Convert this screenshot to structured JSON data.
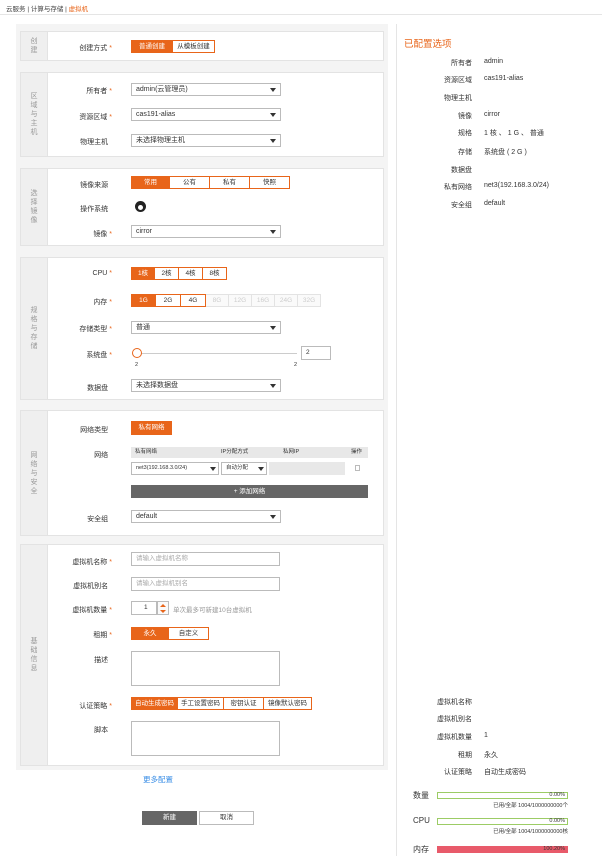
{
  "breadcrumb": {
    "a": "云服务",
    "sep1": "|",
    "b": "计算与存储",
    "sep2": "|",
    "c": "虚拟机"
  },
  "sections": {
    "create": "创建",
    "region": "区域与主机",
    "image": "选择镜像",
    "spec": "规格与存储",
    "network": "网络与安全",
    "basic": "基础信息"
  },
  "create": {
    "label": "创建方式",
    "opt1": "普通创建",
    "opt2": "从模板创建"
  },
  "owner": {
    "label": "所有者",
    "value": "admin(云管理员)"
  },
  "region": {
    "label": "资源区域",
    "value": "cas191-alias"
  },
  "host": {
    "label": "物理主机",
    "value": "未选择物理主机"
  },
  "img_source": {
    "label": "镜像来源",
    "opts": [
      "常用",
      "公有",
      "私有",
      "快照"
    ]
  },
  "os": {
    "label": "操作系统"
  },
  "image": {
    "label": "镜像",
    "value": "cirror"
  },
  "cpu": {
    "label": "CPU",
    "opts": [
      "1核",
      "2核",
      "4核",
      "8核"
    ]
  },
  "mem": {
    "label": "内存",
    "opts": [
      "1G",
      "2G",
      "4G",
      "8G",
      "12G",
      "16G",
      "24G",
      "32G"
    ]
  },
  "storage_type": {
    "label": "存储类型",
    "value": "普通"
  },
  "sysdisk": {
    "label": "系统盘",
    "value": "2",
    "min": "2",
    "max": "2"
  },
  "datadisk": {
    "label": "数据盘",
    "value": "未选择数据盘"
  },
  "nettype": {
    "label": "网络类型",
    "value": "私有网络"
  },
  "network": {
    "label": "网络",
    "headers": [
      "私有网络",
      "IP分配方式",
      "私网IP",
      "操作"
    ],
    "net": "net3(192.168.3.0/24)",
    "alloc": "自动分配",
    "add": "+ 添加网络"
  },
  "secgroup": {
    "label": "安全组",
    "value": "default"
  },
  "vmname": {
    "label": "虚拟机名称",
    "placeholder": "请输入虚拟机名称"
  },
  "vmalias": {
    "label": "虚拟机别名",
    "placeholder": "请输入虚拟机别名"
  },
  "vmcount": {
    "label": "虚拟机数量",
    "value": "1",
    "hint": "单次最多可新建10台虚拟机"
  },
  "lease": {
    "label": "租期",
    "opt1": "永久",
    "opt2": "自定义"
  },
  "desc": {
    "label": "描述"
  },
  "auth": {
    "label": "认证策略",
    "opts": [
      "自动生成密码",
      "手工设置密码",
      "密钥认证",
      "镜像默认密码"
    ]
  },
  "script": {
    "label": "脚本"
  },
  "more": "更多配置",
  "actions": {
    "create": "新建",
    "cancel": "取消"
  },
  "right": {
    "title": "已配置选项",
    "rows": [
      {
        "k": "所有者",
        "v": "admin"
      },
      {
        "k": "资源区域",
        "v": "cas191-alias"
      },
      {
        "k": "物理主机",
        "v": ""
      },
      {
        "k": "镜像",
        "v": "cirror"
      },
      {
        "k": "规格",
        "v": "1 核 、 1 G 、 普通"
      },
      {
        "k": "存储",
        "v": "系统盘 ( 2 G )"
      },
      {
        "k": "数据盘",
        "v": ""
      },
      {
        "k": "私有网络",
        "v": "net3(192.168.3.0/24)"
      },
      {
        "k": "安全组",
        "v": "default"
      }
    ],
    "rows2": [
      {
        "k": "虚拟机名称",
        "v": ""
      },
      {
        "k": "虚拟机别名",
        "v": ""
      },
      {
        "k": "虚拟机数量",
        "v": "1"
      },
      {
        "k": "租期",
        "v": "永久"
      },
      {
        "k": "认证策略",
        "v": "自动生成密码"
      }
    ],
    "quotas": [
      {
        "label": "数量",
        "pct": "0.00%",
        "sub": "已用/全部 1004/1000000000个",
        "fill": 0,
        "color": "#9ccc65"
      },
      {
        "label": "CPU",
        "pct": "0.00%",
        "sub": "已用/全部 1004/1000000000核",
        "fill": 0,
        "color": "#9ccc65"
      },
      {
        "label": "内存",
        "pct": "100.20%",
        "sub": "",
        "fill": 1,
        "color": "#e85a6a"
      }
    ]
  }
}
